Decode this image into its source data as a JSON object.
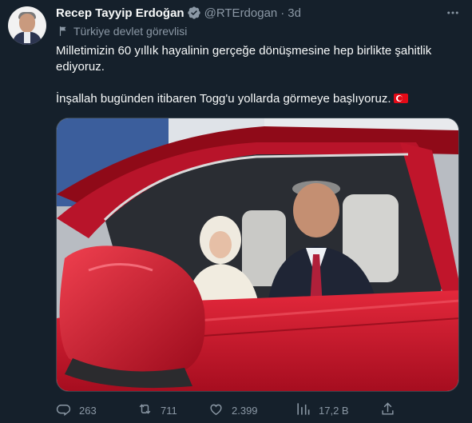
{
  "tweet": {
    "author_name": "Recep Tayyip Erdoğan",
    "handle": "@RTErdogan",
    "separator": "·",
    "time": "3d",
    "affiliation": "Türkiye devlet görevlisi",
    "text_line1": "Milletimizin 60 yıllık hayalinin gerçeğe dönüşmesine hep birlikte şahitlik ediyoruz.",
    "text_line2": "İnşallah bugünden itibaren Togg'u yollarda görmeye başlıyoruz."
  },
  "actions": {
    "replies": "263",
    "retweets": "711",
    "likes": "2.399",
    "views": "17,2 B"
  },
  "icons": {
    "verified": "verified-badge-icon",
    "more": "more-icon",
    "affiliation": "flag-icon",
    "reply": "reply-icon",
    "retweet": "retweet-icon",
    "like": "heart-icon",
    "views": "views-icon",
    "share": "share-icon"
  },
  "colors": {
    "background": "#15202b",
    "text": "#f7f9f9",
    "muted": "#8b98a5",
    "verified": "#1d9bf0",
    "car_red": "#c8102e"
  }
}
